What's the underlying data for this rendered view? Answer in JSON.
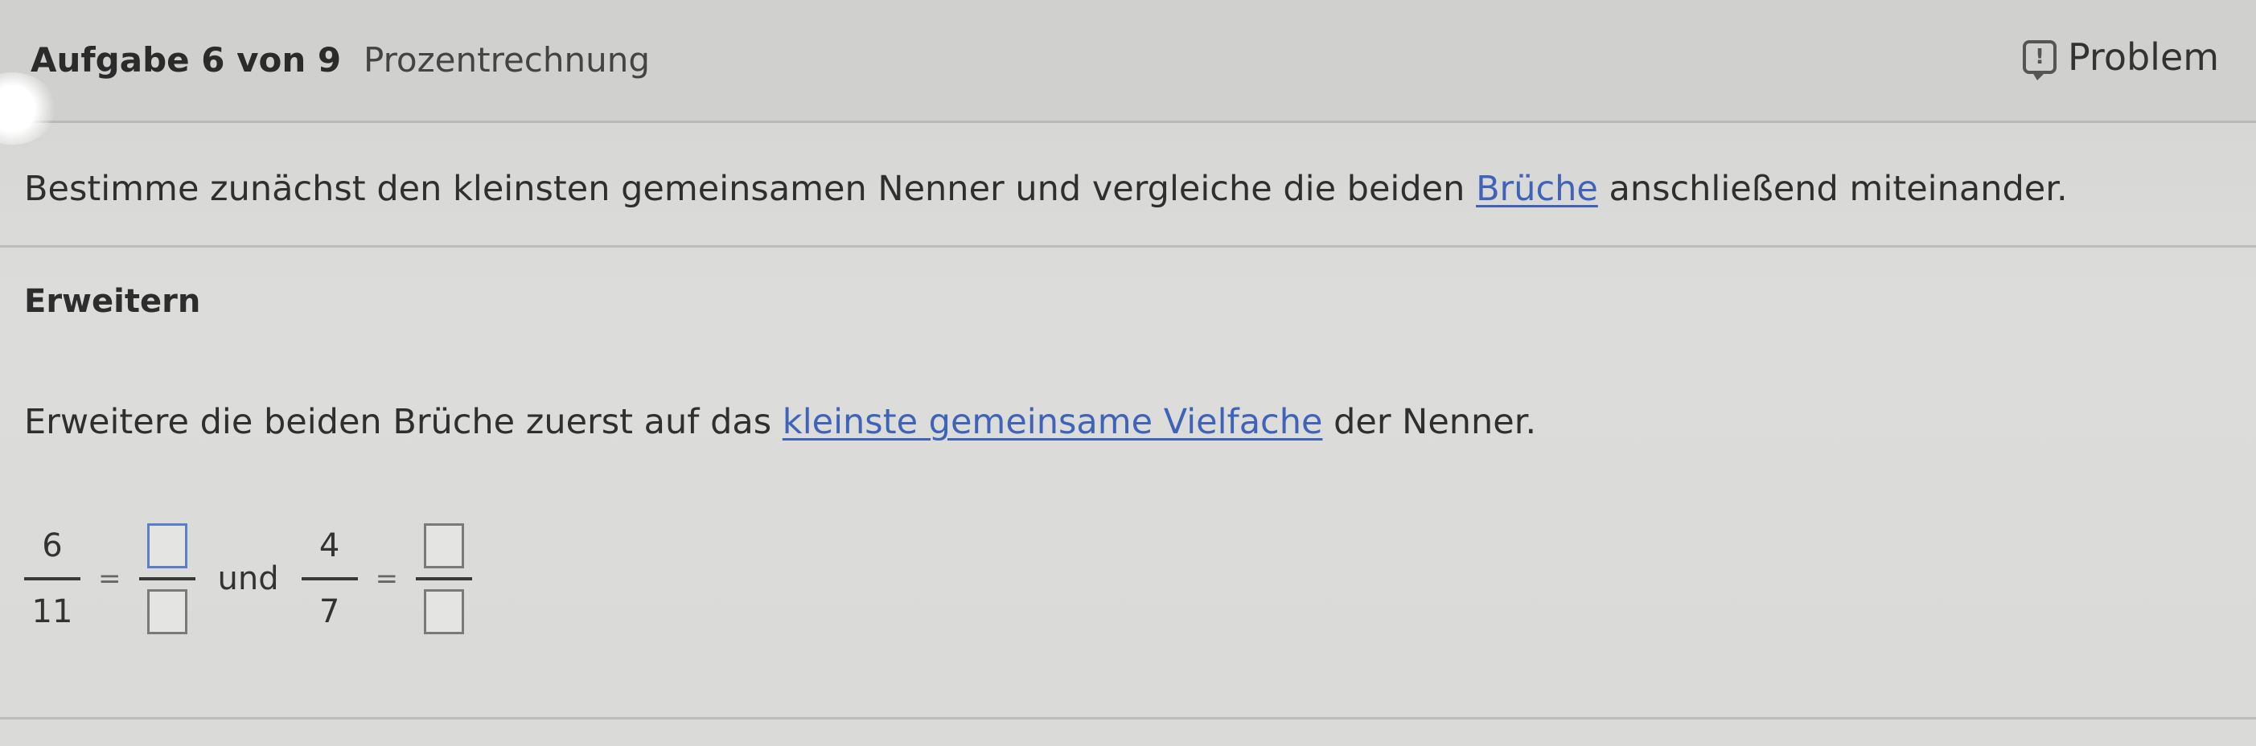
{
  "header": {
    "task_counter": "Aufgabe 6 von 9",
    "topic": "Prozentrechnung",
    "problem_label": "Problem",
    "problem_icon_glyph": "!"
  },
  "instruction": {
    "before": "Bestimme zunächst den kleinsten gemeinsamen Nenner und vergleiche die beiden ",
    "link": "Brüche",
    "after": " anschließend miteinander."
  },
  "section": {
    "title": "Erweitern",
    "text_before": "Erweitere die beiden Brüche zuerst auf das ",
    "link": "kleinste gemeinsame Vielfache",
    "text_after": " der Nenner."
  },
  "equation": {
    "fraction1": {
      "numerator": "6",
      "denominator": "11"
    },
    "fraction2": {
      "numerator": "4",
      "denominator": "7"
    },
    "equals": "=",
    "connector": "und"
  },
  "colors": {
    "link": "#3f63b8",
    "background": "#d8d8d6"
  }
}
